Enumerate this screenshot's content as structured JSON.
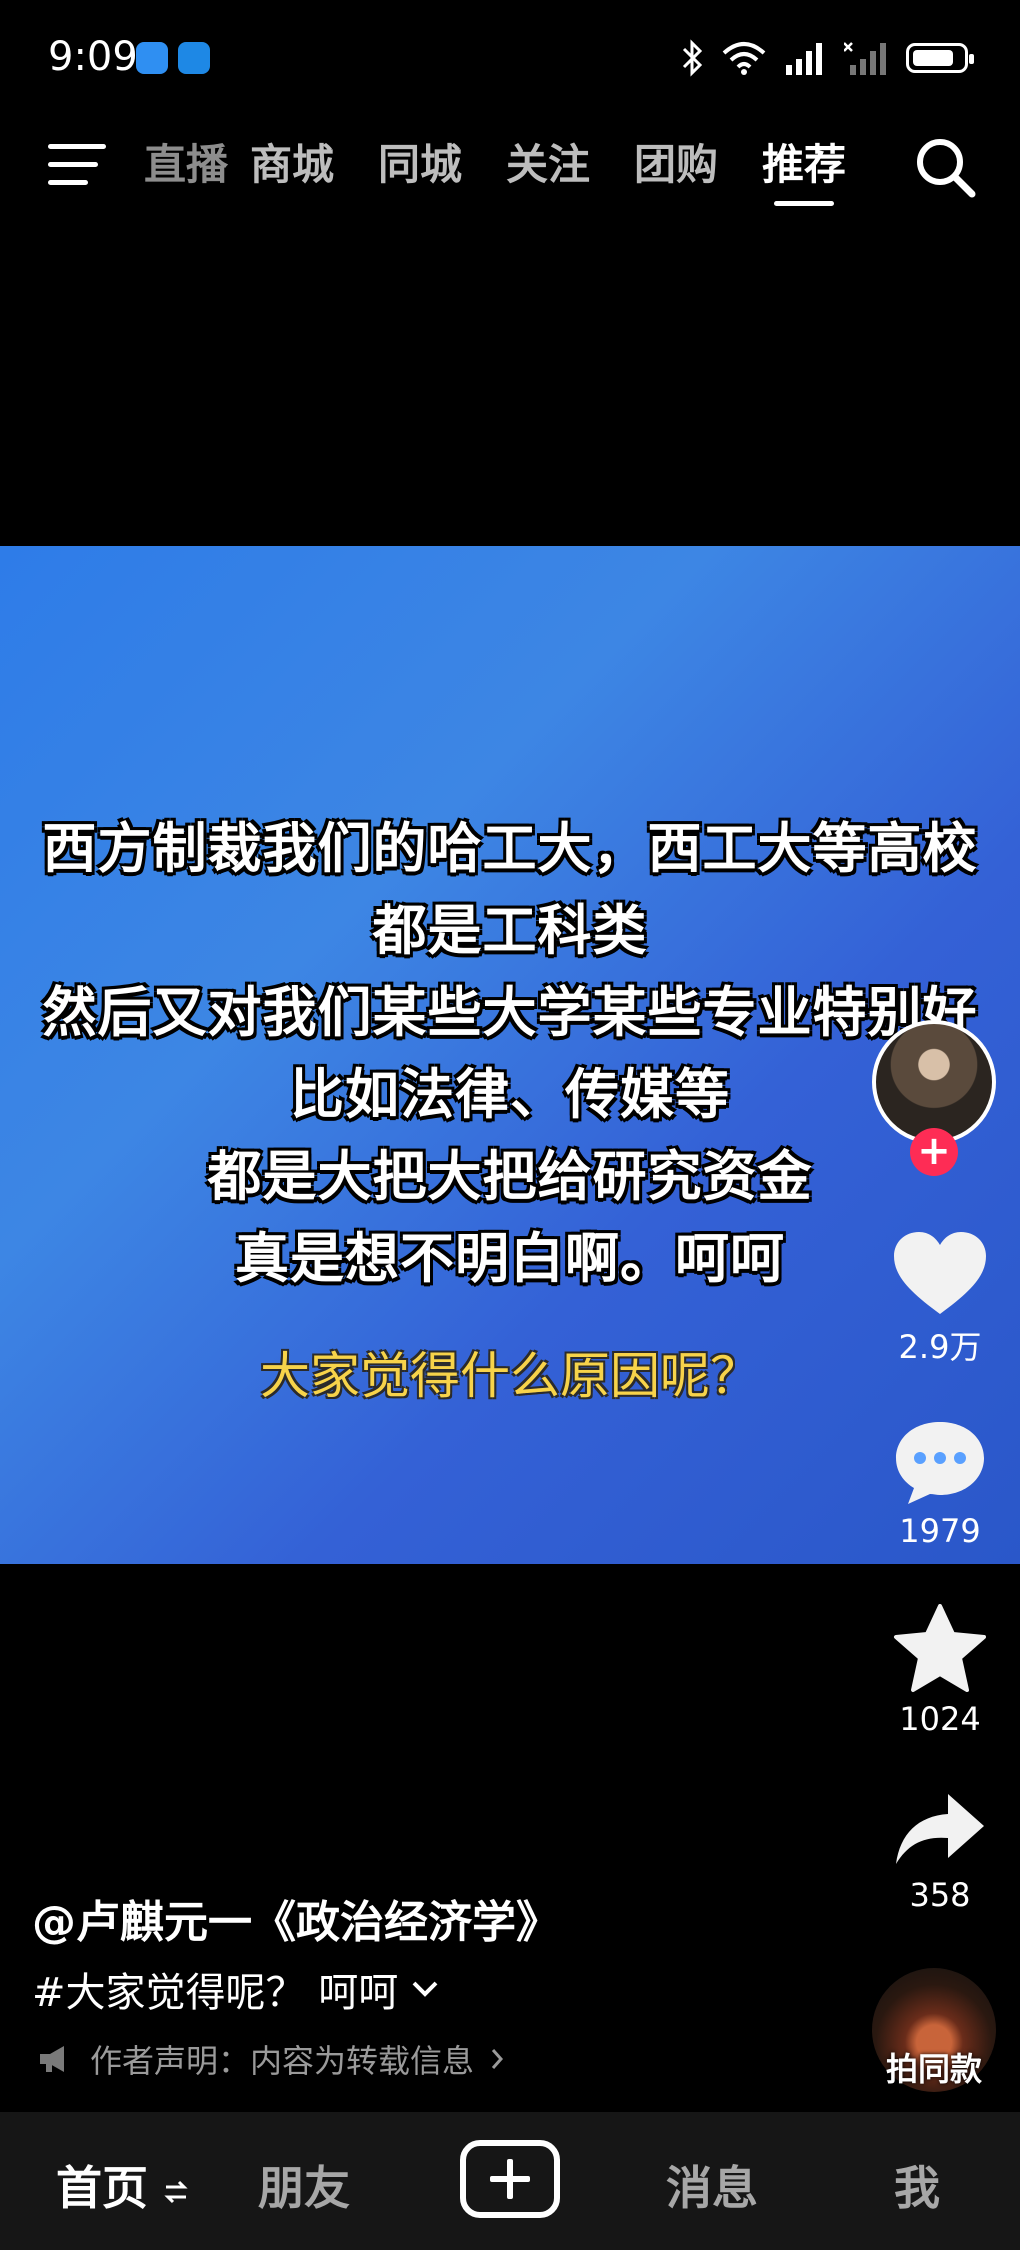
{
  "status_bar": {
    "time": "9:09",
    "icons": [
      "weather-app-icon",
      "browser-app-icon",
      "bluetooth-icon",
      "wifi-icon",
      "signal-icon",
      "signal-off-icon",
      "battery-icon"
    ]
  },
  "top_nav": {
    "tabs": [
      {
        "label": "直播",
        "active": false
      },
      {
        "label": "商城",
        "active": false
      },
      {
        "label": "同城",
        "active": false
      },
      {
        "label": "关注",
        "active": false
      },
      {
        "label": "团购",
        "active": false
      },
      {
        "label": "推荐",
        "active": true
      }
    ]
  },
  "video": {
    "caption_lines": [
      "西方制裁我们的哈工大，西工大等高校",
      "都是工科类",
      "然后又对我们某些大学某些专业特别好",
      "比如法律、传媒等",
      "都是大把大把给研究资金",
      "真是想不明白啊。呵呵"
    ],
    "question": "大家觉得什么原因呢？",
    "background_colors": [
      "#2e7ce8",
      "#2a57c9"
    ]
  },
  "actions": {
    "likes": "2.9万",
    "comments": "1979",
    "favorites": "1024",
    "shares": "358",
    "follow_symbol": "+"
  },
  "post": {
    "author": "@卢麒元一《政治经济学》",
    "tags": "#大家觉得呢？ 呵呵",
    "notice": "作者声明：内容为转载信息",
    "same_style_label": "拍同款"
  },
  "bottom_nav": {
    "home": "首页",
    "friends": "朋友",
    "messages": "消息",
    "me": "我"
  },
  "colors": {
    "accent_follow": "#fe2c55",
    "question_text": "#f7d34a",
    "nav_bg": "#161616"
  }
}
